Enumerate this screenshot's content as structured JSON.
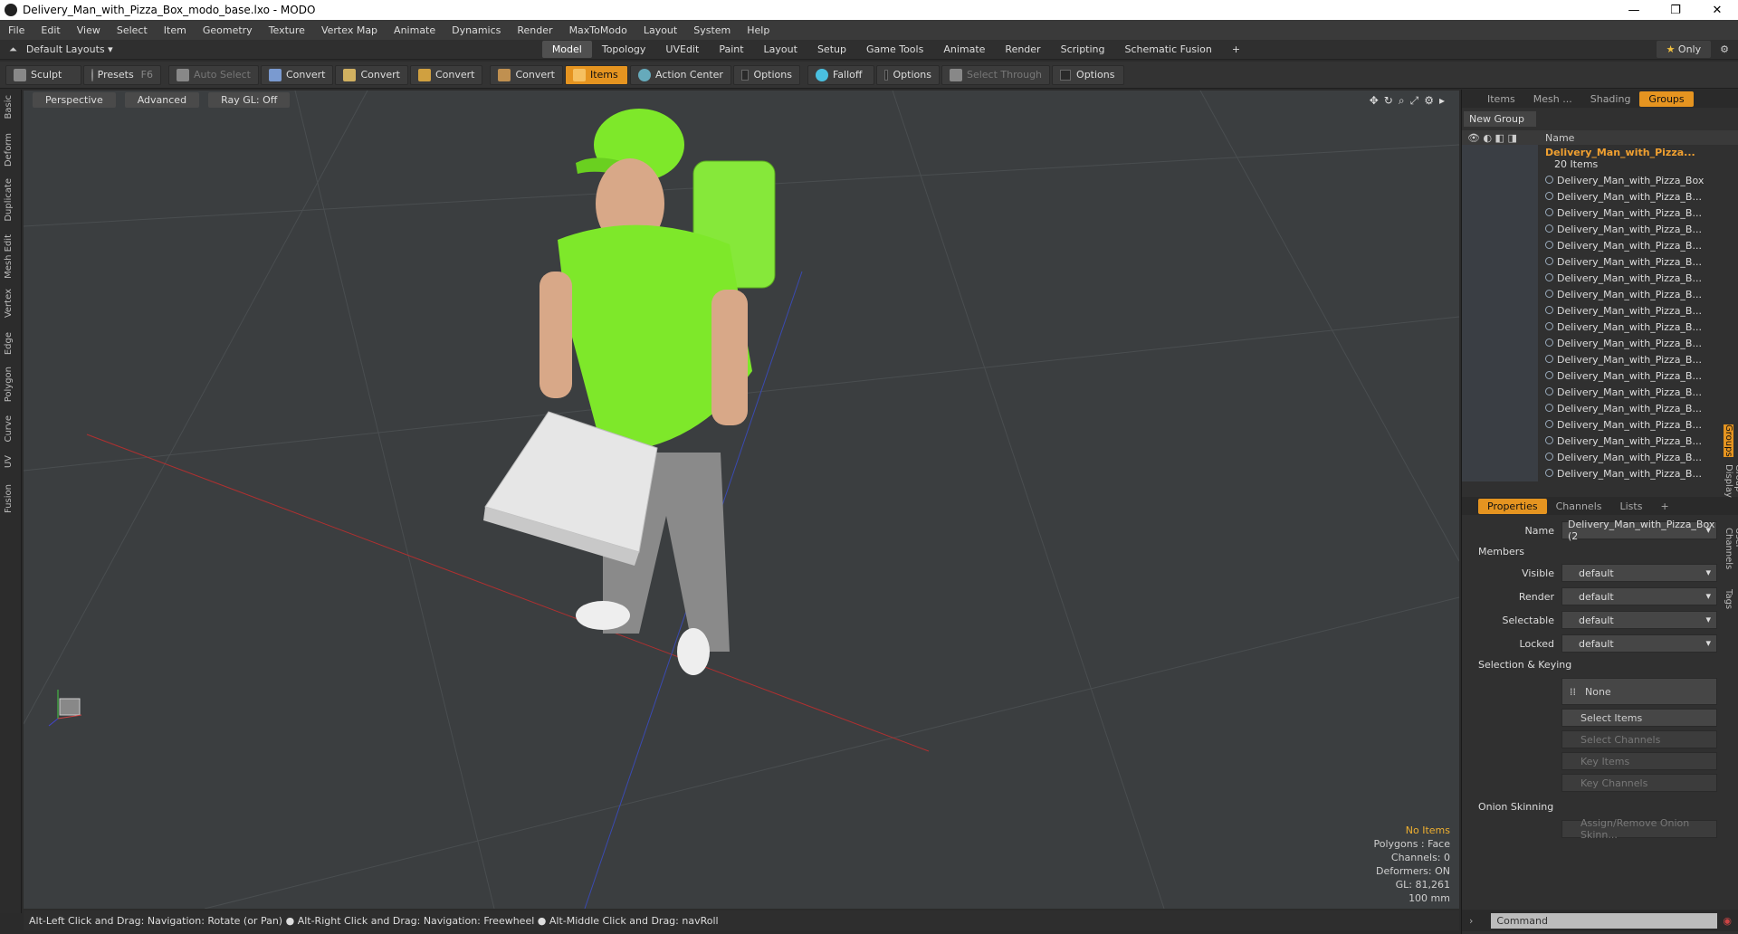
{
  "window": {
    "title": "Delivery_Man_with_Pizza_Box_modo_base.lxo - MODO"
  },
  "menu": [
    "File",
    "Edit",
    "View",
    "Select",
    "Item",
    "Geometry",
    "Texture",
    "Vertex Map",
    "Animate",
    "Dynamics",
    "Render",
    "MaxToModo",
    "Layout",
    "System",
    "Help"
  ],
  "layouts": {
    "selector": "Default Layouts ▾",
    "tabs": [
      "Model",
      "Topology",
      "UVEdit",
      "Paint",
      "Layout",
      "Setup",
      "Game Tools",
      "Animate",
      "Render",
      "Scripting",
      "Schematic Fusion"
    ],
    "active": "Model",
    "only": "Only"
  },
  "toolbar": {
    "sculpt": "Sculpt",
    "presets": "Presets",
    "presets_key": "F6",
    "auto_select": "Auto Select",
    "convert1": "Convert",
    "convert2": "Convert",
    "convert3": "Convert",
    "convert4": "Convert",
    "items": "Items",
    "action_center": "Action Center",
    "options1": "Options",
    "falloff": "Falloff",
    "options2": "Options",
    "select_through": "Select Through",
    "options3": "Options"
  },
  "left_tabs": [
    "Basic",
    "Deform",
    "Duplicate",
    "Mesh Edit",
    "Vertex",
    "Edge",
    "Polygon",
    "Curve",
    "UV",
    "Fusion"
  ],
  "viewport": {
    "view": "Perspective",
    "shading": "Advanced",
    "raygl": "Ray GL: Off",
    "info": {
      "items": "No Items",
      "polygons": "Polygons : Face",
      "channels": "Channels: 0",
      "deformers": "Deformers: ON",
      "gl": "GL: 81,261",
      "scale": "100 mm"
    }
  },
  "status": "Alt-Left Click and Drag: Navigation: Rotate (or Pan) ● Alt-Right Click and Drag: Navigation: Freewheel ● Alt-Middle Click and Drag: navRoll",
  "panel_tabs": [
    "Items",
    "Mesh ...",
    "Shading",
    "Groups"
  ],
  "groups": {
    "new_group": "New Group",
    "name_header": "Name",
    "group_name": "Delivery_Man_with_Pizza...",
    "group_count": "20 Items",
    "rows": [
      "Delivery_Man_with_Pizza_Box",
      "Delivery_Man_with_Pizza_B...",
      "Delivery_Man_with_Pizza_B...",
      "Delivery_Man_with_Pizza_B...",
      "Delivery_Man_with_Pizza_B...",
      "Delivery_Man_with_Pizza_B...",
      "Delivery_Man_with_Pizza_B...",
      "Delivery_Man_with_Pizza_B...",
      "Delivery_Man_with_Pizza_B...",
      "Delivery_Man_with_Pizza_B...",
      "Delivery_Man_with_Pizza_B...",
      "Delivery_Man_with_Pizza_B...",
      "Delivery_Man_with_Pizza_B...",
      "Delivery_Man_with_Pizza_B...",
      "Delivery_Man_with_Pizza_B...",
      "Delivery_Man_with_Pizza_B...",
      "Delivery_Man_with_Pizza_B...",
      "Delivery_Man_with_Pizza_B...",
      "Delivery_Man_with_Pizza_B..."
    ]
  },
  "props_tabs": [
    "Properties",
    "Channels",
    "Lists",
    "+"
  ],
  "props": {
    "name_label": "Name",
    "name_value": "Delivery_Man_with_Pizza_Box (2",
    "members": "Members",
    "visible": "Visible",
    "render": "Render",
    "selectable": "Selectable",
    "locked": "Locked",
    "default": "default",
    "sel_keying": "Selection & Keying",
    "none": "None",
    "select_items": "Select Items",
    "select_channels": "Select Channels",
    "key_items": "Key Items",
    "key_channels": "Key Channels",
    "onion": "Onion Skinning",
    "assign": "Assign/Remove Onion Skinn..."
  },
  "side_vtabs": [
    "Groups",
    "Group Display",
    "User Channels",
    "Tags"
  ],
  "command": {
    "placeholder": "Command"
  },
  "colors": {
    "accent": "#e59420",
    "shirt": "#7ee82a"
  }
}
